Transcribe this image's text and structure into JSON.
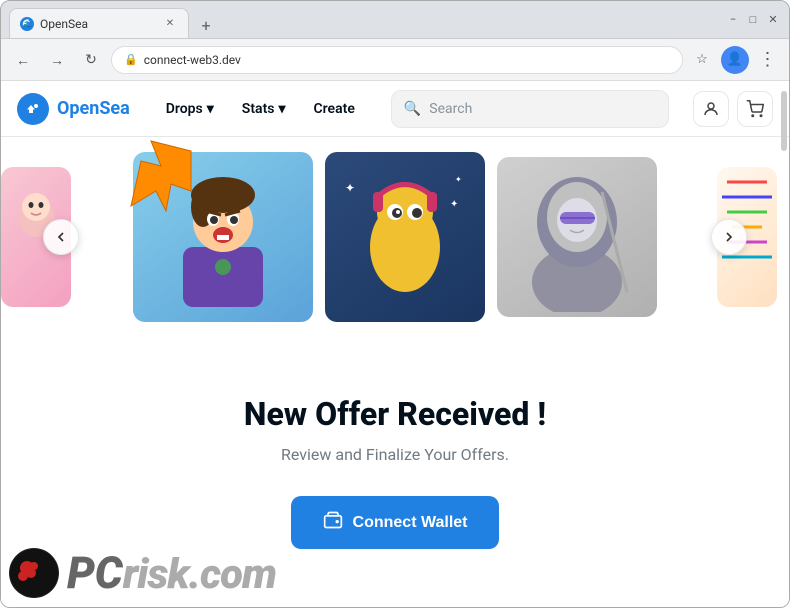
{
  "browser": {
    "tab_title": "OpenSea",
    "tab_favicon": "🌊",
    "new_tab_icon": "+",
    "url": "connect-web3.dev",
    "back_icon": "←",
    "forward_icon": "→",
    "refresh_icon": "↻",
    "minimize_icon": "−",
    "maximize_icon": "□",
    "close_icon": "✕",
    "more_icon": "⋮",
    "star_icon": "☆",
    "tab_close_icon": "✕"
  },
  "opensea": {
    "logo_text": "OpenSea",
    "nav_items": [
      {
        "label": "Drops",
        "id": "drops"
      },
      {
        "label": "Stats",
        "id": "stats"
      },
      {
        "label": "Create",
        "id": "create"
      }
    ],
    "search_placeholder": "Search",
    "user_icon": "👤",
    "cart_icon": "🛒"
  },
  "carousel": {
    "left_arrow": "‹",
    "right_arrow": "›",
    "cards": [
      {
        "id": "card-1",
        "bg": "#f8c8d4"
      },
      {
        "id": "card-2",
        "bg": "#87ceeb"
      },
      {
        "id": "card-3",
        "bg": "#2c4a7a"
      },
      {
        "id": "card-4",
        "bg": "#c8c8c8"
      },
      {
        "id": "card-5",
        "bg": "#fff8f0"
      }
    ]
  },
  "main": {
    "offer_title": "New Offer Received !",
    "offer_subtitle": "Review and Finalize Your Offers.",
    "connect_wallet_label": "Connect Wallet",
    "wallet_icon": "💳"
  },
  "watermark": {
    "text": "PCrisk.com",
    "pc_text": "PC",
    "risk_text": "risk.com"
  }
}
